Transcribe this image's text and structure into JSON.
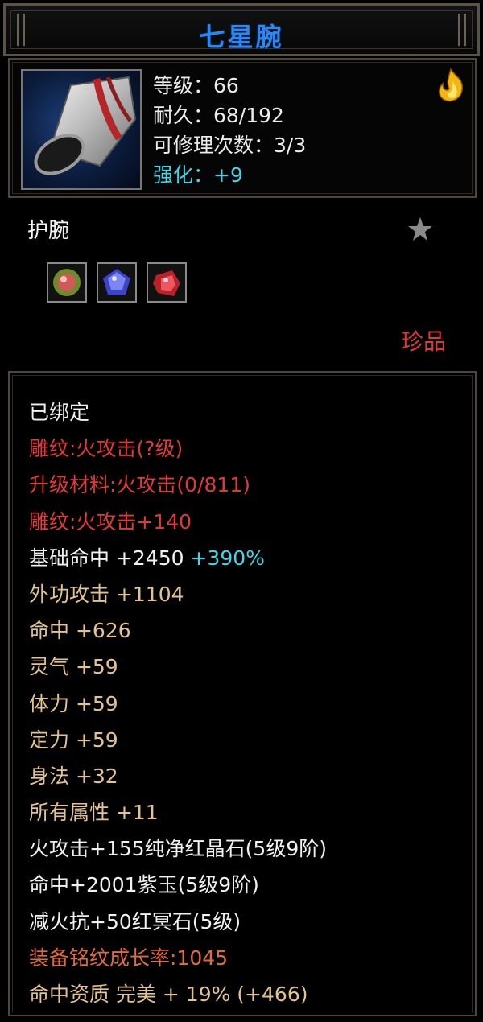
{
  "title": "七星腕",
  "header": {
    "level": "等级：66",
    "durability": "耐久：68/192",
    "repair_count": "可修理次数：3/3",
    "enhance": "强化：+9"
  },
  "item_type": "护腕",
  "quality": "珍品",
  "gems": [
    {
      "name": "red-green-gem",
      "color": "#c8585a"
    },
    {
      "name": "purple-gem",
      "color": "#4b52d8"
    },
    {
      "name": "red-gem",
      "color": "#d8313a"
    }
  ],
  "attributes": {
    "bound": "已绑定",
    "engrave_level": "雕纹:火攻击(?级)",
    "upgrade_material": "升级材料:火攻击(0/811)",
    "engrave_bonus": "雕纹:火攻击+140",
    "base_hit": "基础命中  +2450",
    "base_hit_pct": "+390%",
    "outer_attack": "外功攻击  +1104",
    "hit": "命中  +626",
    "spirit": "灵气  +59",
    "stamina": "体力  +59",
    "focus": "定力  +59",
    "agility": "身法  +32",
    "all_attributes": "所有属性  +11",
    "gem_fire": "火攻击+155纯净红晶石(5级9阶)",
    "gem_hit": "命中+2001紫玉(5级9阶)",
    "gem_resist": "减火抗+50红冥石(5级)",
    "growth_rate": "装备铭纹成长率:1045",
    "hit_quality": "命中资质  完美  + 19% (+466)"
  },
  "colors": {
    "title_blue": "#2f86ef",
    "attr_red": "#e2383a",
    "attr_tan": "#e3c38f",
    "enhance_cyan": "#3fd6e6",
    "growth_orange": "#e06a3a"
  },
  "icons": {
    "item": "bracer-icon",
    "flame": "flame-icon",
    "star": "star-icon"
  }
}
